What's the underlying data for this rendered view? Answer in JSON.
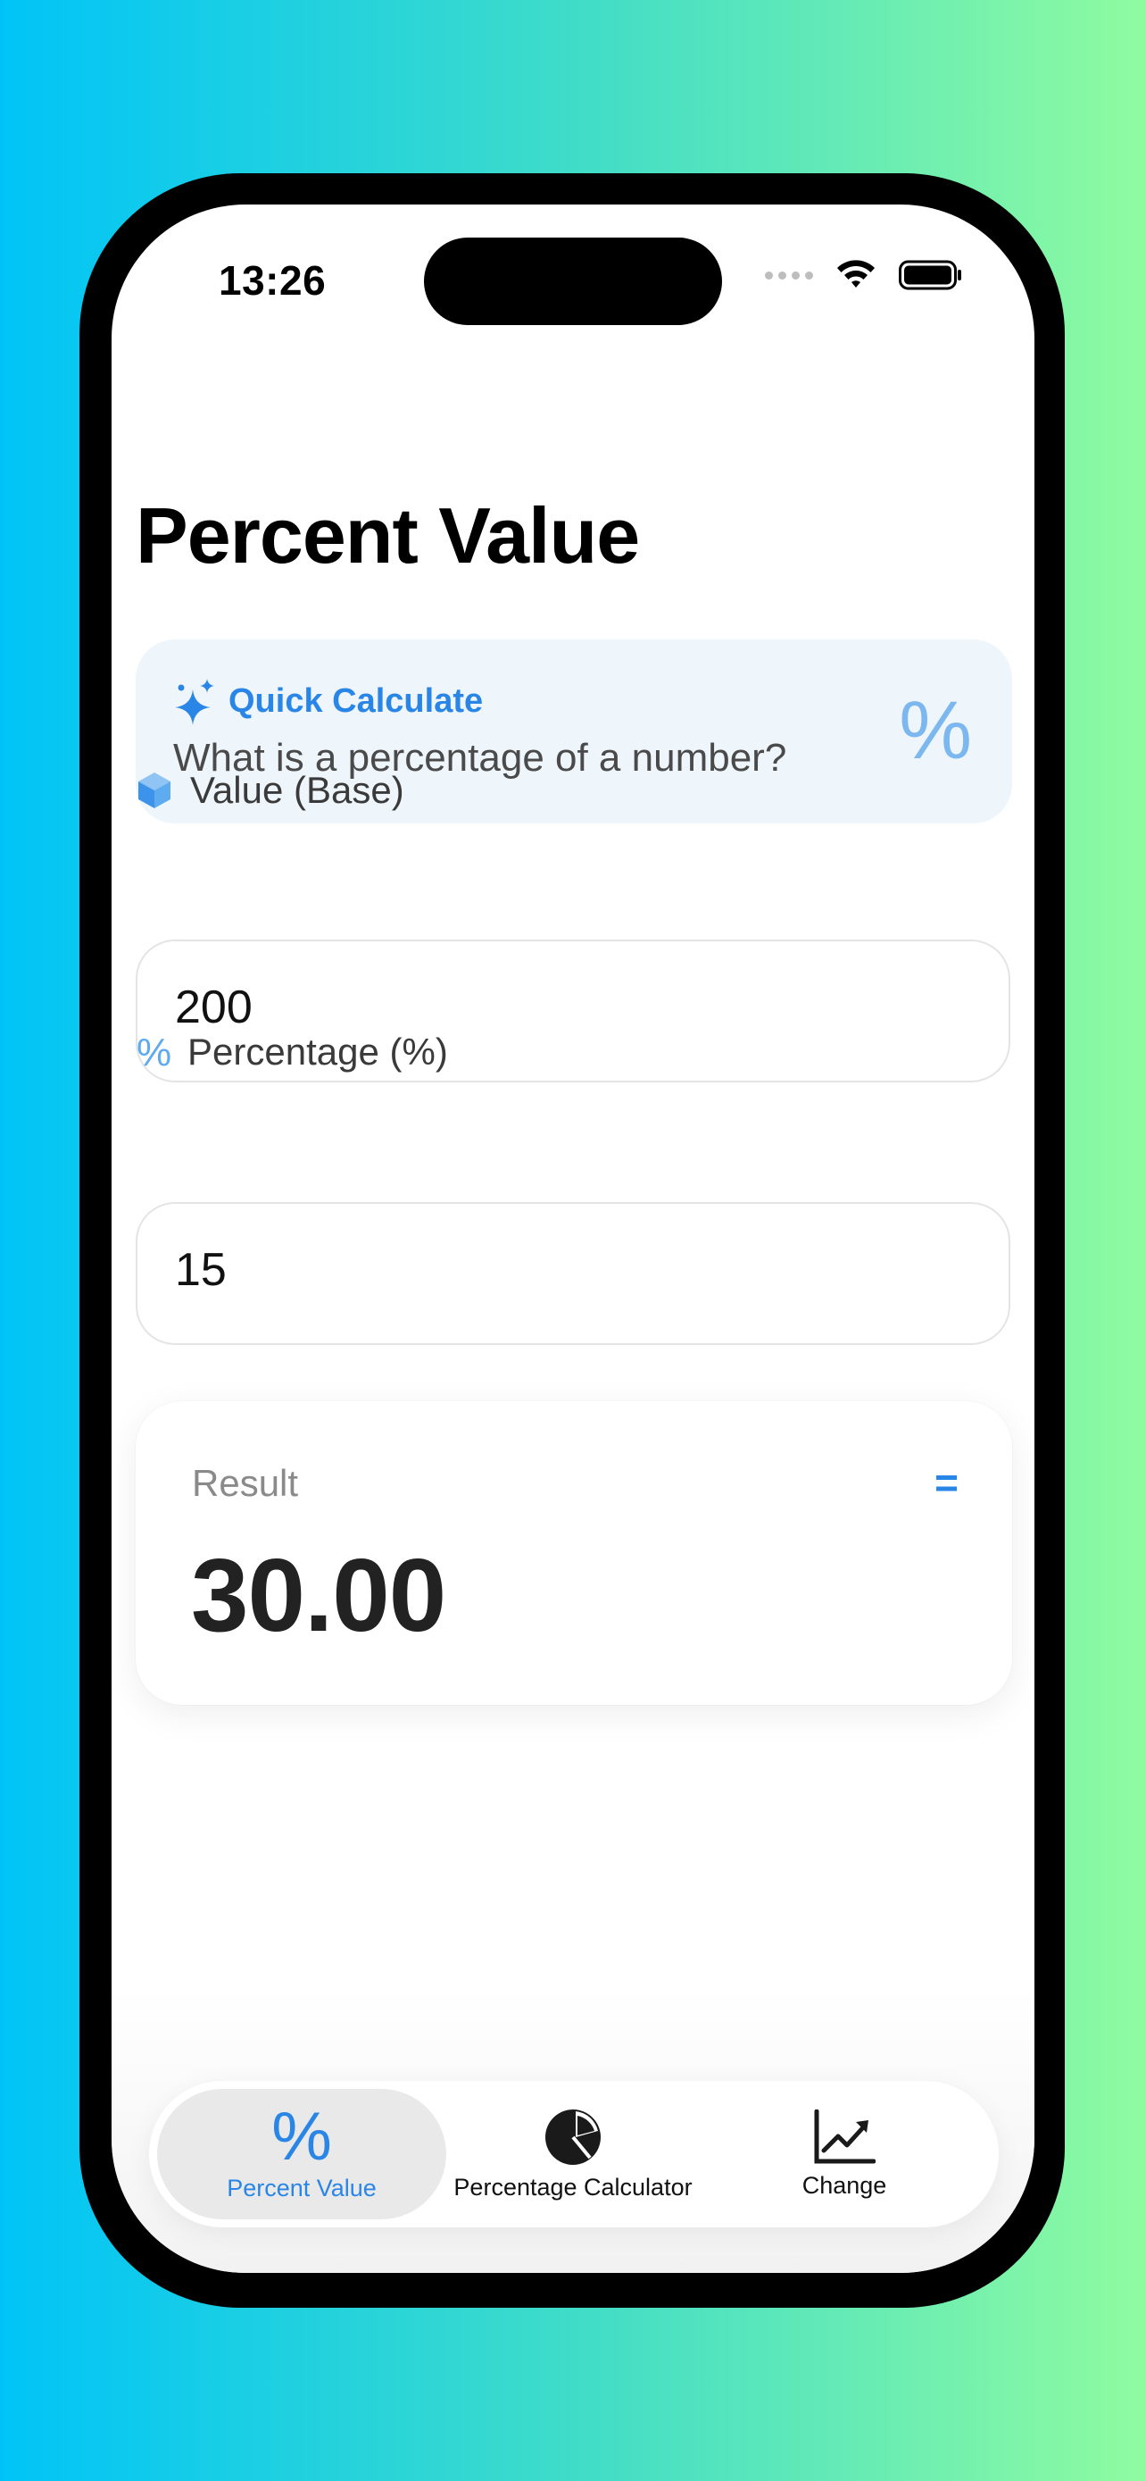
{
  "status": {
    "time": "13:26"
  },
  "page": {
    "title": "Percent Value"
  },
  "quick": {
    "title": "Quick Calculate",
    "subtitle": "What is a percentage of a number?",
    "symbol": "%"
  },
  "fields": {
    "base": {
      "label": "Value (Base)",
      "value": "200"
    },
    "percent": {
      "label": "Percentage (%)",
      "icon_text": "%",
      "value": "15"
    }
  },
  "result": {
    "label": "Result",
    "symbol": "=",
    "value": "30.00"
  },
  "tabs": [
    {
      "label": "Percent Value",
      "icon": "percent-icon",
      "active": true
    },
    {
      "label": "Percentage Calculator",
      "icon": "pie-chart-icon",
      "active": false
    },
    {
      "label": "Change",
      "icon": "trend-chart-icon",
      "active": false
    }
  ],
  "colors": {
    "accent": "#2a86e6",
    "card_bg": "#eef6fc"
  }
}
